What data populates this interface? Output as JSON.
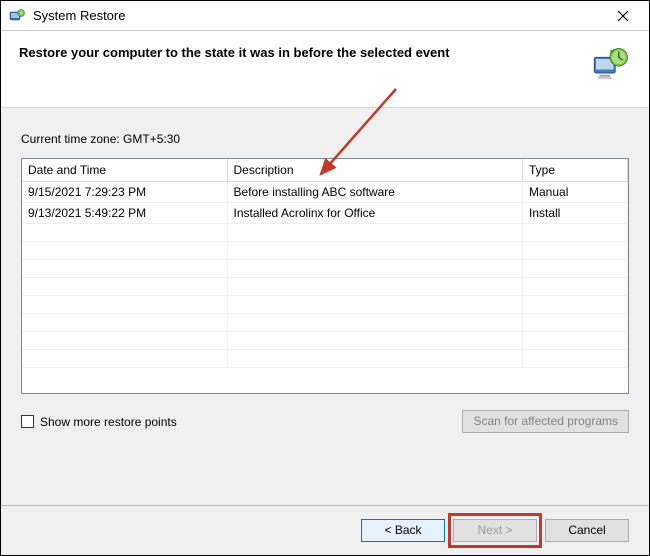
{
  "titlebar": {
    "title": "System Restore"
  },
  "header": {
    "heading": "Restore your computer to the state it was in before the selected event"
  },
  "body": {
    "timezone_label": "Current time zone: GMT+5:30",
    "columns": {
      "date": "Date and Time",
      "desc": "Description",
      "type": "Type"
    },
    "rows": [
      {
        "date": "9/15/2021 7:29:23 PM",
        "desc": "Before installing ABC software",
        "type": "Manual"
      },
      {
        "date": "9/13/2021 5:49:22 PM",
        "desc": "Installed Acrolinx for Office",
        "type": "Install"
      }
    ],
    "show_more_label": "Show more restore points",
    "scan_button_label": "Scan for affected programs"
  },
  "buttons": {
    "back": "< Back",
    "next": "Next >",
    "cancel": "Cancel"
  }
}
